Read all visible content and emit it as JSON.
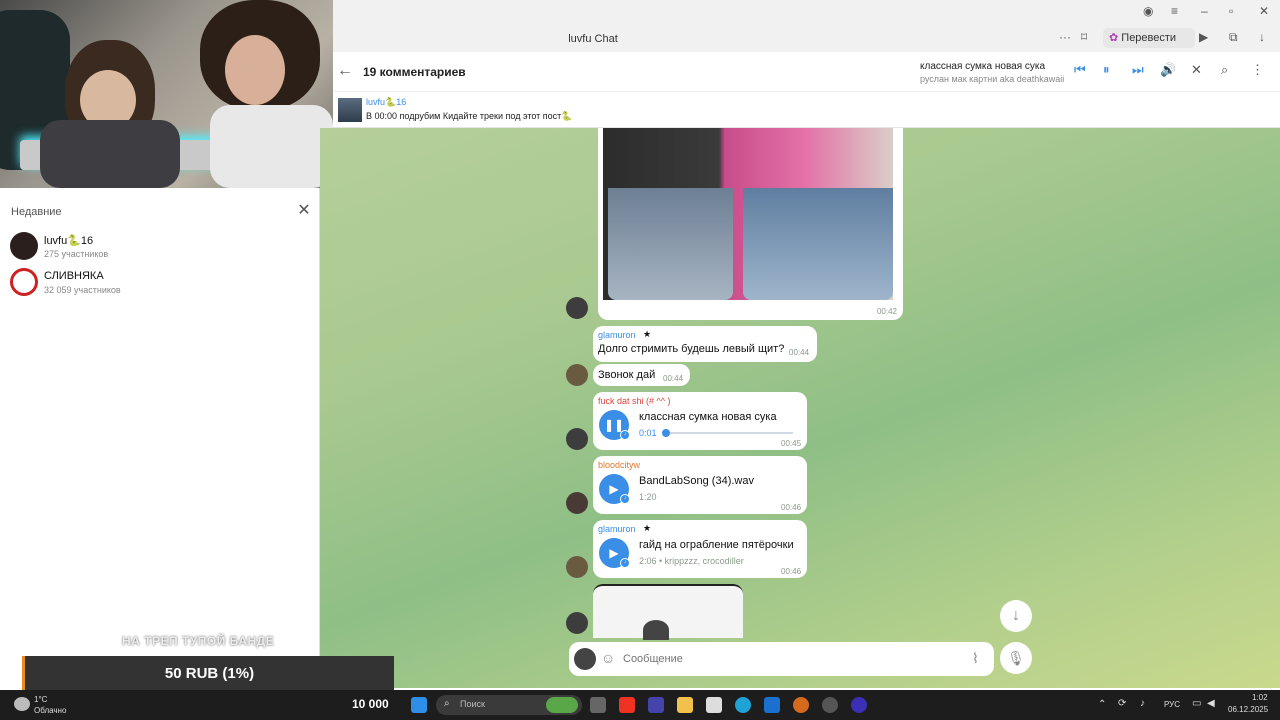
{
  "window": {
    "title": "luvfu Chat",
    "translate_label": "Перевести",
    "menu_dots": "···"
  },
  "topbar": {
    "comments_title": "19 комментариев",
    "player_title": "классная сумка новая сука",
    "player_subtitle": "руслан мак картни aka deathkawaii"
  },
  "pinned": {
    "name": "luvfu🐍16",
    "text": "В 00:00 подрубим Кидайте треки под этот пост🐍"
  },
  "recent": {
    "title": "Недавние",
    "items": [
      {
        "name": "luvfu🐍16",
        "sub": "275 участников"
      },
      {
        "name": "СЛИВНЯКА",
        "sub": "32 059 участников"
      }
    ]
  },
  "messages": {
    "photo_time": "00:42",
    "m1": {
      "author": "glamuron",
      "author_color": "#3a8ee6",
      "text": "Долго стримить будешь левый щит?",
      "time": "00:44"
    },
    "m2": {
      "text": "Звонок дай",
      "time": "00:44"
    },
    "m3": {
      "author": "fuck dat shi (# ^^ )",
      "author_color": "#d9463e",
      "title": "классная сумка новая сука",
      "duration": "0:01",
      "progress": 0.02,
      "time": "00:45"
    },
    "m4": {
      "author": "bloodcityw",
      "author_color": "#e0792a",
      "title": "BandLabSong (34).wav",
      "duration": "1:20",
      "time": "00:46"
    },
    "m5": {
      "author": "glamuron",
      "author_color": "#3a8ee6",
      "title": "гайд на ограбление пятёрочки",
      "duration": "2:06 • krippzzz, crocodiller",
      "time": "00:46"
    }
  },
  "composer": {
    "placeholder": "Сообщение"
  },
  "stream": {
    "donation_text": "НА ТРЕП ТУПОЙ БАНДЕ",
    "donation_amount": "50 RUB (1%)"
  },
  "taskbar": {
    "weather_temp": "1°C",
    "weather_text": "Облачно",
    "counter": "10 000",
    "search_placeholder": "Поиск",
    "lang": "РУС",
    "time": "1:02",
    "date": "06.12.2025"
  },
  "colors": {
    "accent": "#3a8ee6",
    "chat_bg": "#a8c98f"
  }
}
